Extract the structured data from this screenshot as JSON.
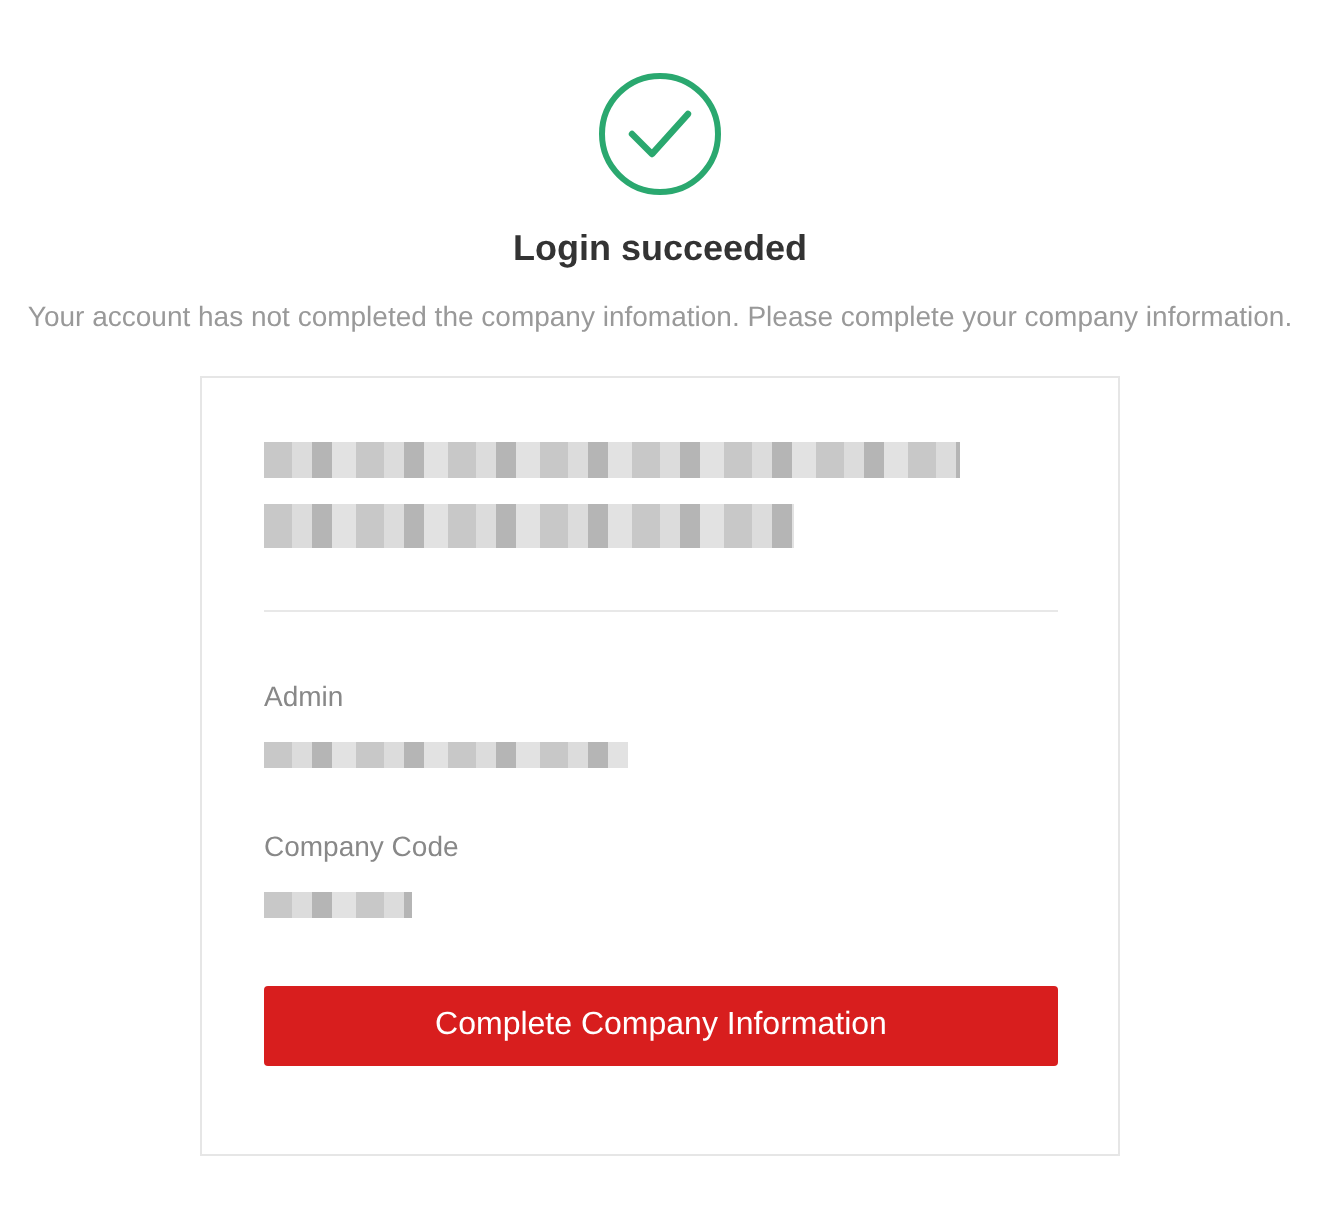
{
  "status": {
    "title": "Login succeeded",
    "message": "Your account has not completed the company infomation. Please complete your company information."
  },
  "card": {
    "fields": [
      {
        "label": "Admin"
      },
      {
        "label": "Company Code"
      }
    ],
    "button": "Complete Company Information"
  }
}
